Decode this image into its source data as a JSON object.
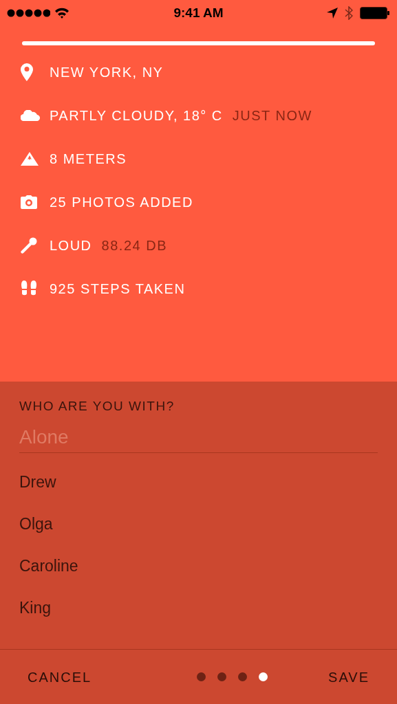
{
  "status_bar": {
    "time": "9:41 AM"
  },
  "details": [
    {
      "kind": "location",
      "text": "NEW YORK, NY"
    },
    {
      "kind": "weather",
      "text": "PARTLY CLOUDY, 18° C",
      "detail": "JUST NOW"
    },
    {
      "kind": "elevation",
      "text": "8 METERS"
    },
    {
      "kind": "photos",
      "text": "25 PHOTOS ADDED"
    },
    {
      "kind": "sound",
      "text": "LOUD",
      "detail": "88.24 DB"
    },
    {
      "kind": "steps",
      "text": "925 STEPS TAKEN"
    }
  ],
  "companions": {
    "heading": "WHO ARE YOU WITH?",
    "placeholder": "Alone",
    "people": [
      "Drew",
      "Olga",
      "Caroline",
      "King"
    ]
  },
  "footer": {
    "cancel": "CANCEL",
    "save": "SAVE",
    "pages": [
      {
        "selected": false
      },
      {
        "selected": false
      },
      {
        "selected": false
      },
      {
        "selected": true
      }
    ]
  }
}
